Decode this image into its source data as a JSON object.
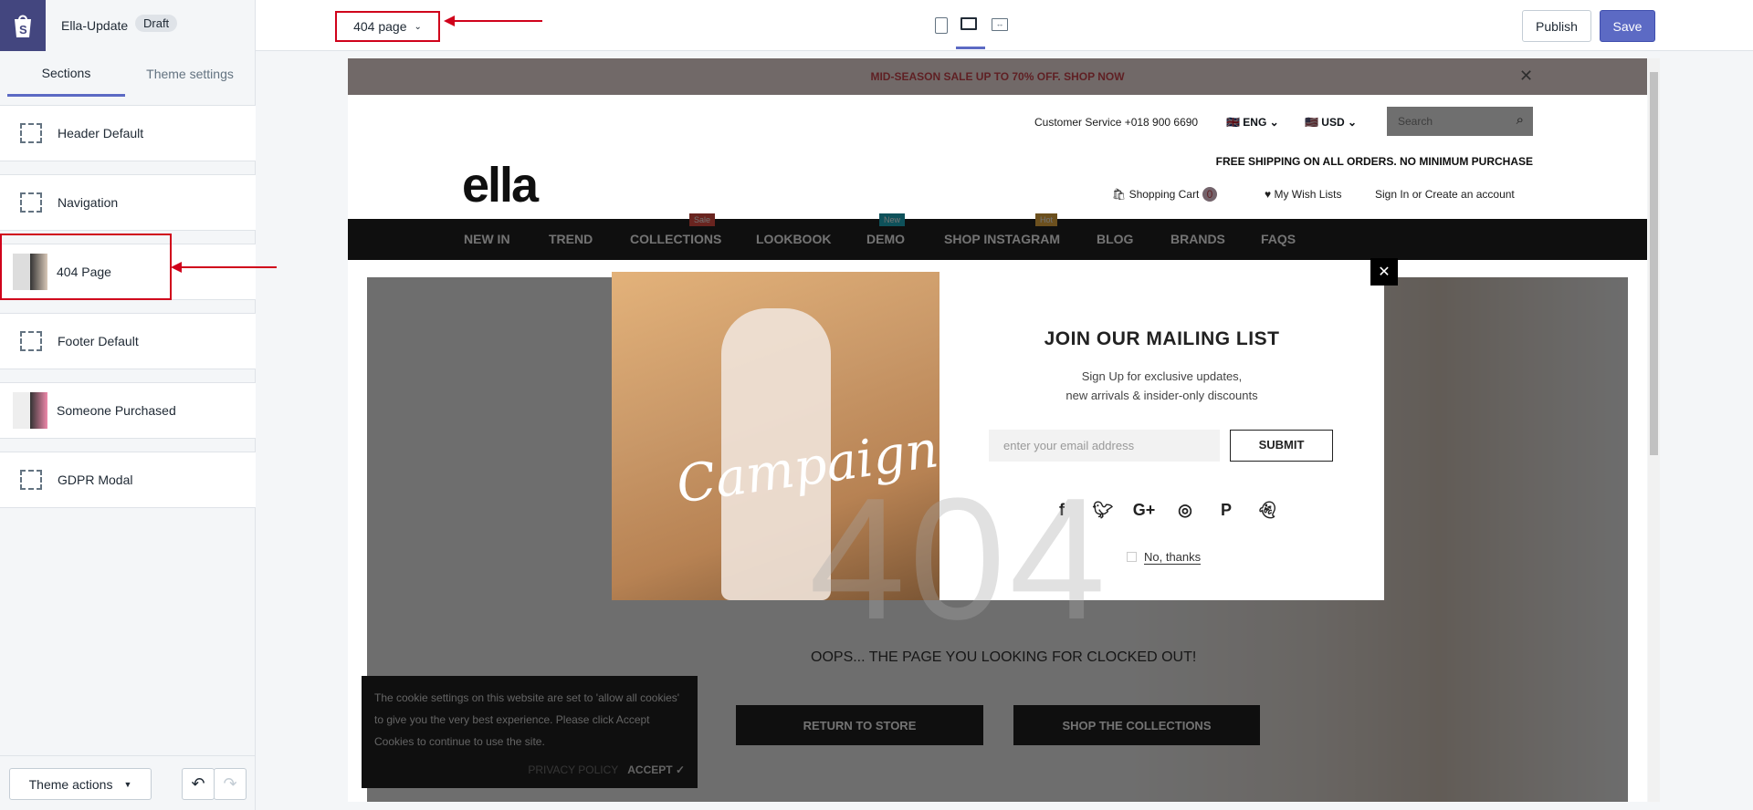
{
  "app": {
    "store_name": "Ella-Update",
    "status_badge": "Draft",
    "page_select": "404 page",
    "publish": "Publish",
    "save": "Save",
    "accent": "#5c6ac4"
  },
  "tabs": [
    "Sections",
    "Theme settings"
  ],
  "sections": [
    {
      "label": "Header Default",
      "icon": "section-icon"
    },
    {
      "label": "Navigation",
      "icon": "section-icon"
    },
    {
      "label": "404 Page",
      "icon": "thumbnail"
    },
    {
      "label": "Footer Default",
      "icon": "section-icon"
    },
    {
      "label": "Someone Purchased",
      "icon": "thumbnail"
    },
    {
      "label": "GDPR Modal",
      "icon": "section-icon"
    }
  ],
  "footer": {
    "theme_actions": "Theme actions"
  },
  "store": {
    "promo": "MID-SEASON SALE UP TO 70% OFF. SHOP NOW",
    "customer_service": "Customer Service +018 900 6690",
    "language": "ENG",
    "currency": "USD",
    "search_placeholder": "Search",
    "free_shipping": "FREE SHIPPING ON ALL ORDERS. NO MINIMUM PURCHASE",
    "logo": "ella",
    "cart": "Shopping Cart",
    "cart_count": "0",
    "wishlist": "My Wish Lists",
    "account": "Sign In or Create an account",
    "nav": [
      "NEW IN",
      "TREND",
      "COLLECTIONS",
      "LOOKBOOK",
      "DEMO",
      "SHOP INSTAGRAM",
      "BLOG",
      "BRANDS",
      "FAQS"
    ],
    "nav_badges": {
      "sale": "Sale",
      "new": "New",
      "hot": "Hot"
    },
    "big_404": "404",
    "oops": "OOPS... THE PAGE YOU LOOKING FOR CLOCKED OUT!",
    "return": "RETURN TO STORE",
    "shop": "SHOP THE COLLECTIONS",
    "cookie_text": "The cookie settings on this website are set to 'allow all cookies' to give you the very best experience. Please click Accept Cookies to continue to use the site.",
    "privacy": "PRIVACY POLICY",
    "accept": "ACCEPT"
  },
  "popup": {
    "image_text": "Campaigns",
    "title": "JOIN OUR MAILING LIST",
    "line1": "Sign Up for exclusive updates,",
    "line2": "new arrivals & insider-only discounts",
    "email_placeholder": "enter your email address",
    "submit": "SUBMIT",
    "no_thanks": "No, thanks",
    "close": "✕",
    "socials": [
      "f",
      "t",
      "G+",
      "ig",
      "P",
      "sc"
    ]
  }
}
